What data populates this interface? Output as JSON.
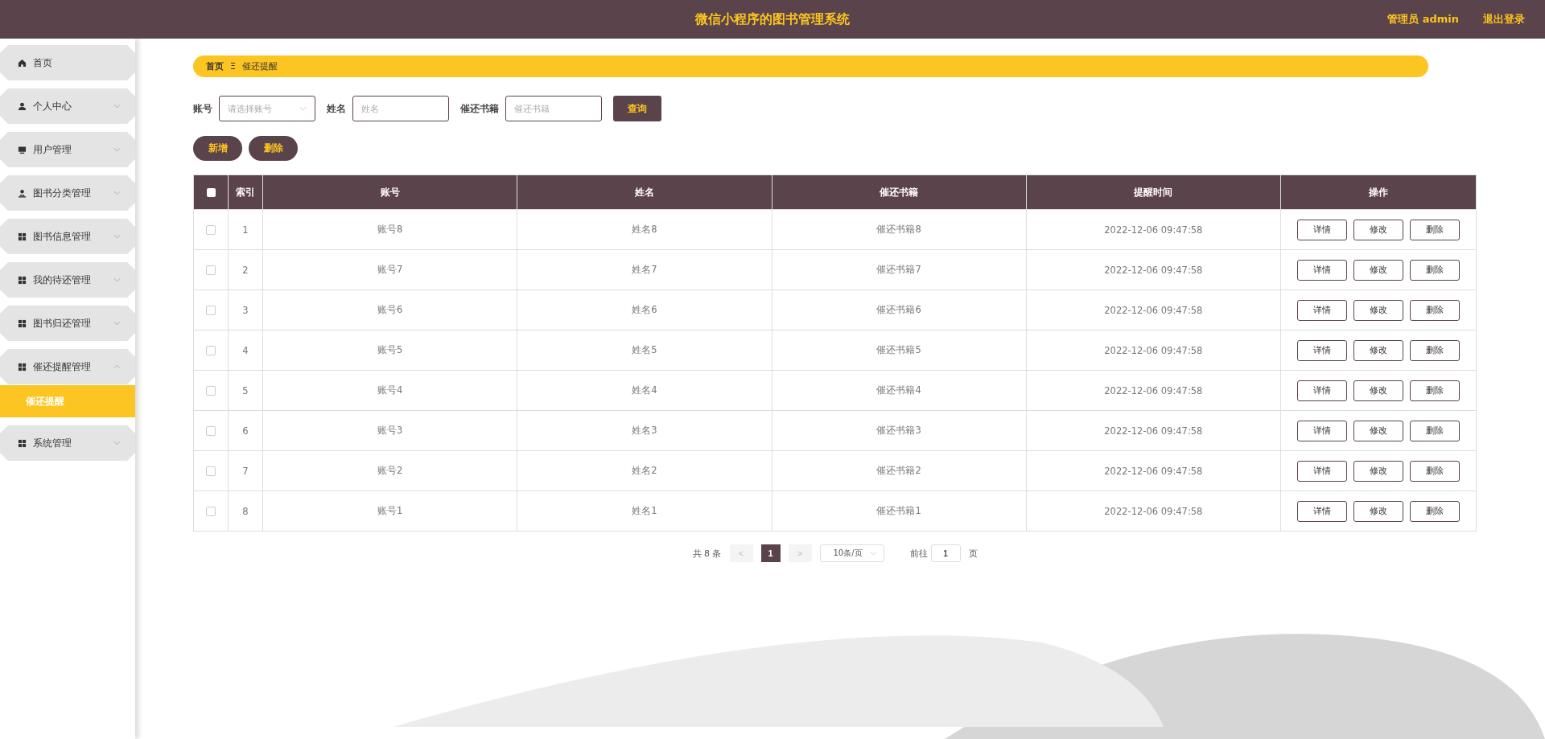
{
  "header": {
    "title": "微信小程序的图书管理系统",
    "user": "管理员 admin",
    "logout": "退出登录"
  },
  "sidebar": {
    "items": [
      {
        "label": "首页",
        "kind": "link"
      },
      {
        "label": "个人中心",
        "kind": "submenu",
        "expanded": false
      },
      {
        "label": "用户管理",
        "kind": "submenu",
        "expanded": false
      },
      {
        "label": "图书分类管理",
        "kind": "submenu",
        "expanded": false
      },
      {
        "label": "图书信息管理",
        "kind": "submenu",
        "expanded": false
      },
      {
        "label": "我的待还管理",
        "kind": "submenu",
        "expanded": false
      },
      {
        "label": "图书归还管理",
        "kind": "submenu",
        "expanded": false
      },
      {
        "label": "催还提醒管理",
        "kind": "submenu",
        "expanded": true,
        "children": [
          {
            "label": "催还提醒",
            "selected": true
          }
        ]
      },
      {
        "label": "系统管理",
        "kind": "submenu",
        "expanded": false
      }
    ]
  },
  "breadcrumb": {
    "items": [
      "首页",
      "催还提醒"
    ],
    "separator": "Ξ"
  },
  "search": {
    "fields": [
      {
        "label": "账号",
        "kind": "select",
        "placeholder": "请选择账号"
      },
      {
        "label": "姓名",
        "kind": "input",
        "placeholder": "姓名"
      },
      {
        "label": "催还书籍",
        "kind": "input",
        "placeholder": "催还书籍"
      }
    ],
    "button": "查询"
  },
  "actions": [
    "新增",
    "删除"
  ],
  "table": {
    "all_checked": false,
    "columns": [
      "索引",
      "账号",
      "姓名",
      "催还书籍",
      "提醒时间",
      "操作"
    ],
    "rows": [
      {
        "checked": false,
        "cells": [
          "1",
          "账号8",
          "姓名8",
          "催还书籍8",
          "2022-12-06 09:47:58"
        ],
        "buttons": [
          "详情",
          "修改",
          "删除"
        ]
      },
      {
        "checked": false,
        "cells": [
          "2",
          "账号7",
          "姓名7",
          "催还书籍7",
          "2022-12-06 09:47:58"
        ],
        "buttons": [
          "详情",
          "修改",
          "删除"
        ]
      },
      {
        "checked": false,
        "cells": [
          "3",
          "账号6",
          "姓名6",
          "催还书籍6",
          "2022-12-06 09:47:58"
        ],
        "buttons": [
          "详情",
          "修改",
          "删除"
        ]
      },
      {
        "checked": false,
        "cells": [
          "4",
          "账号5",
          "姓名5",
          "催还书籍5",
          "2022-12-06 09:47:58"
        ],
        "buttons": [
          "详情",
          "修改",
          "删除"
        ]
      },
      {
        "checked": false,
        "cells": [
          "5",
          "账号4",
          "姓名4",
          "催还书籍4",
          "2022-12-06 09:47:58"
        ],
        "buttons": [
          "详情",
          "修改",
          "删除"
        ]
      },
      {
        "checked": false,
        "cells": [
          "6",
          "账号3",
          "姓名3",
          "催还书籍3",
          "2022-12-06 09:47:58"
        ],
        "buttons": [
          "详情",
          "修改",
          "删除"
        ]
      },
      {
        "checked": false,
        "cells": [
          "7",
          "账号2",
          "姓名2",
          "催还书籍2",
          "2022-12-06 09:47:58"
        ],
        "buttons": [
          "详情",
          "修改",
          "删除"
        ]
      },
      {
        "checked": false,
        "cells": [
          "8",
          "账号1",
          "姓名1",
          "催还书籍1",
          "2022-12-06 09:47:58"
        ],
        "buttons": [
          "详情",
          "修改",
          "删除"
        ]
      }
    ]
  },
  "pagination": {
    "total": "共 8 条",
    "prev": "<",
    "pages": [
      {
        "label": "1",
        "selected": true
      }
    ],
    "next": ">",
    "page_size": "10条/页",
    "goto": "前往",
    "goto_value": "1",
    "page_unit": "页"
  }
}
